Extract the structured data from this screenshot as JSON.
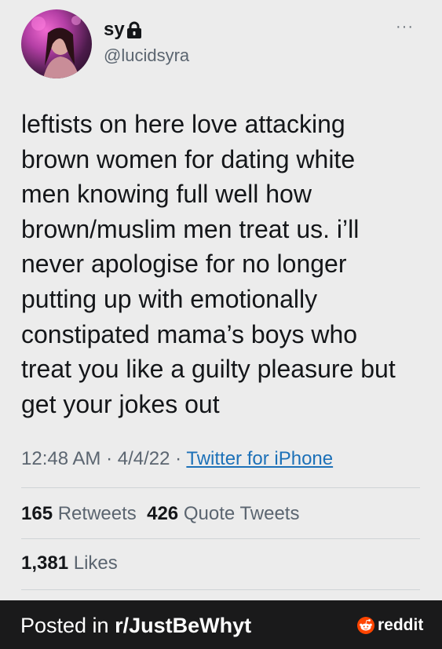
{
  "tweet": {
    "author": {
      "display_name": "sy",
      "handle": "@lucidsyra",
      "locked": true,
      "avatar_icon": "profile-photo"
    },
    "more_label": "···",
    "text": "leftists on here love attacking\nbrown women for dating white\nmen knowing full well how\nbrown/muslim men treat us. i’ll\nnever apologise for no longer\nputting up with emotionally\nconstipated mama’s boys who\ntreat you like a guilty pleasure but\nget your jokes out",
    "time": "12:48 AM",
    "date": "4/4/22",
    "separator": " · ",
    "source": "Twitter for iPhone",
    "stats": {
      "retweets_count": "165",
      "retweets_label": "Retweets",
      "quotes_count": "426",
      "quotes_label": "Quote Tweets",
      "likes_count": "1,381",
      "likes_label": "Likes"
    }
  },
  "footer": {
    "posted_prefix": "Posted in ",
    "subreddit": "r/JustBeWhyt",
    "brand": "reddit",
    "brand_icon": "reddit-alien-icon"
  },
  "colors": {
    "background": "#ececec",
    "link": "#1d71b8",
    "secondary_text": "#5b6570",
    "footer_bg": "#1a1a1b",
    "reddit_orange": "#ff4500"
  }
}
